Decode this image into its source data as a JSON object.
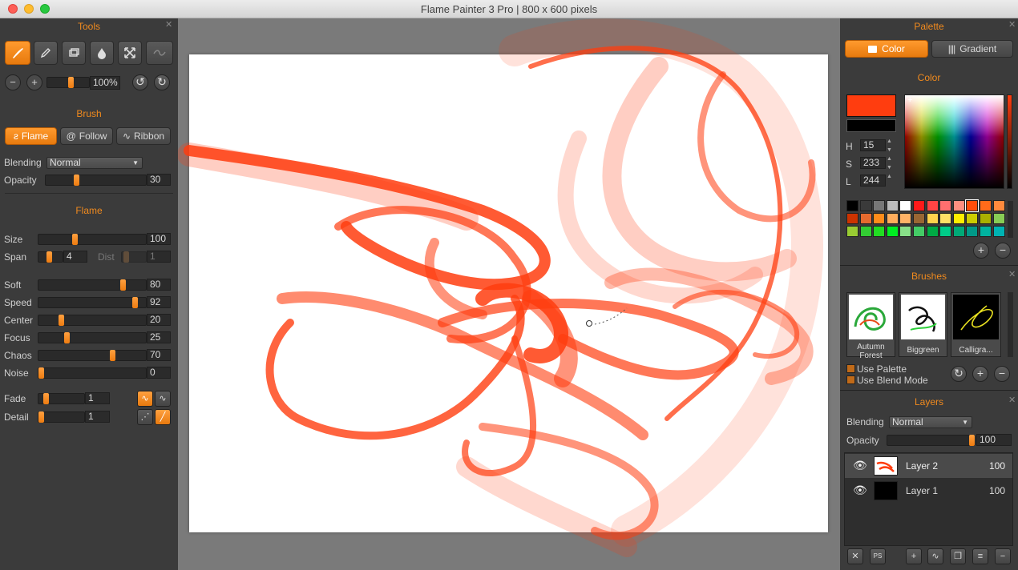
{
  "window": {
    "title": "Flame Painter 3 Pro | 800 x 600 pixels"
  },
  "tools": {
    "title": "Tools",
    "zoom_value": "100%",
    "zoom_level": 0.55,
    "brush_title": "Brush",
    "brush_modes": [
      "Flame",
      "Follow",
      "Ribbon"
    ],
    "blending_label": "Blending",
    "blending_value": "Normal",
    "opacity_label": "Opacity",
    "opacity_value": "30",
    "flame_title": "Flame",
    "size_label": "Size",
    "size_value": "100",
    "span_label": "Span",
    "span_value": "4",
    "dist_label": "Dist",
    "dist_value": "1",
    "params": [
      {
        "label": "Soft",
        "value": "80"
      },
      {
        "label": "Speed",
        "value": "92"
      },
      {
        "label": "Center",
        "value": "20"
      },
      {
        "label": "Focus",
        "value": "25"
      },
      {
        "label": "Chaos",
        "value": "70"
      },
      {
        "label": "Noise",
        "value": "0"
      }
    ],
    "fade_label": "Fade",
    "fade_value": "1",
    "detail_label": "Detail",
    "detail_value": "1"
  },
  "palette": {
    "title": "Palette",
    "tab_color": "Color",
    "tab_gradient": "Gradient",
    "color_title": "Color",
    "primary_color": "#ff3d0f",
    "secondary_color": "#000000",
    "h_label": "H",
    "h_value": "15",
    "s_label": "S",
    "s_value": "233",
    "l_label": "L",
    "l_value": "244",
    "swatches": [
      "#000000",
      "#3a3a3a",
      "#777777",
      "#bbbbbb",
      "#ffffff",
      "#ff1a1a",
      "#ff4444",
      "#ff6f6f",
      "#ff8f80",
      "#ff4d0a",
      "#ff6b1a",
      "#ff8a3d",
      "#cc3300",
      "#e66a2e",
      "#ff8c1a",
      "#ffad5c",
      "#ffb366",
      "#996633",
      "#ffd24d",
      "#ffe066",
      "#ffee00",
      "#cccc00",
      "#aab000",
      "#88cc55",
      "#99cc33",
      "#33cc33",
      "#22dd22",
      "#00ee22",
      "#88e088",
      "#44cc66",
      "#00aa44",
      "#00cc88",
      "#00aa77",
      "#009988",
      "#00b3a0",
      "#00b3b3"
    ]
  },
  "brushes": {
    "title": "Brushes",
    "items": [
      "Autumn Forest",
      "Biggreen",
      "Calligra..."
    ],
    "use_palette": "Use Palette",
    "use_blend_mode": "Use Blend Mode"
  },
  "layers": {
    "title": "Layers",
    "blending_label": "Blending",
    "blending_value": "Normal",
    "opacity_label": "Opacity",
    "opacity_value": "100",
    "items": [
      {
        "name": "Layer 2",
        "opacity": "100"
      },
      {
        "name": "Layer 1",
        "opacity": "100"
      }
    ]
  },
  "accent": "#f08a1e"
}
